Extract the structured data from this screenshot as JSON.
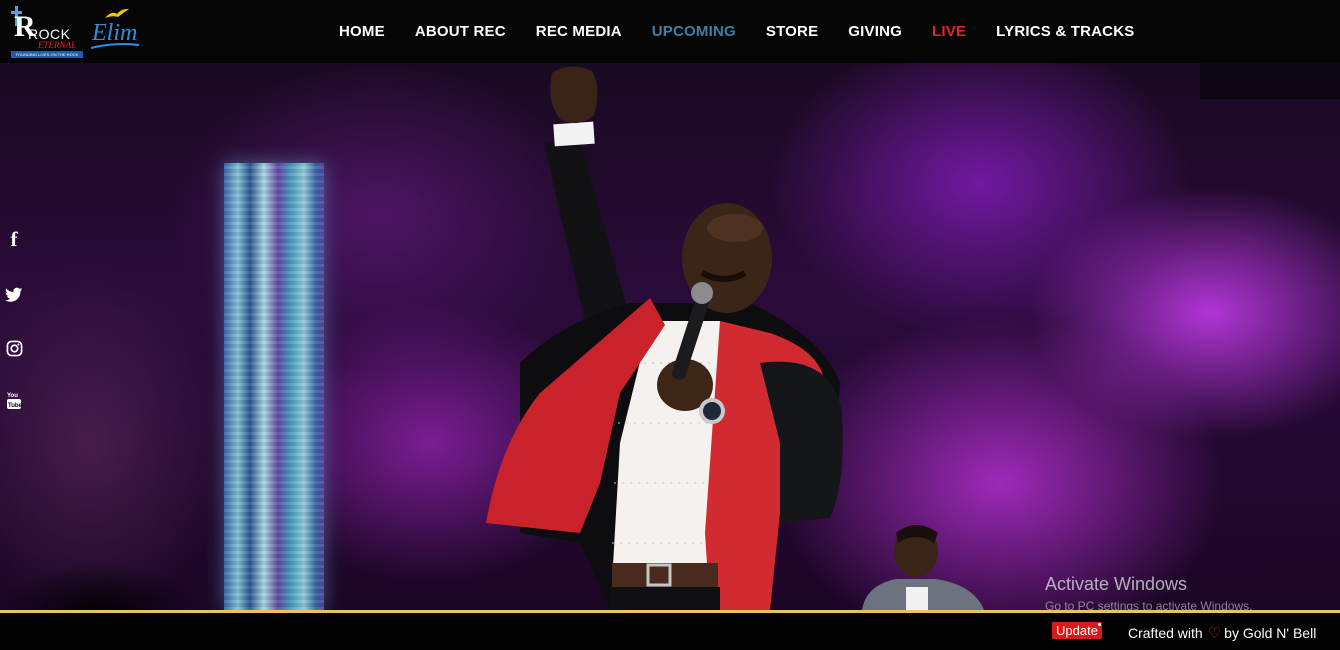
{
  "brand": {
    "rock_logo_text": "ROCK",
    "rock_logo_sub": "ETERNAL",
    "rock_logo_tagline": "FOUNDING LIVES ON THE ROCK",
    "elim_logo_text": "Elim"
  },
  "nav": {
    "items": [
      {
        "label": "HOME",
        "icon": "none"
      },
      {
        "label": "ABOUT REC",
        "icon": "none"
      },
      {
        "label": "REC MEDIA",
        "icon": "none"
      },
      {
        "label": "UPCOMING",
        "icon": "none"
      },
      {
        "label": "STORE",
        "icon": "none"
      },
      {
        "label": "GIVING",
        "icon": "none"
      },
      {
        "label": "LIVE",
        "icon": "none"
      },
      {
        "label": "LYRICS & TRACKS",
        "icon": "none"
      }
    ],
    "colors": {
      "default": "#ffffff",
      "upcoming": "#3f7fa6",
      "live": "#e3232b"
    }
  },
  "social": {
    "icons": [
      "facebook-icon",
      "twitter-icon",
      "instagram-icon",
      "youtube-icon"
    ],
    "facebook_glyph": "f"
  },
  "hero": {
    "image_subject": "worship leader singing into microphone on purple-lit stage"
  },
  "watermark": {
    "line1": "Activate Windows",
    "line2": "Go to PC settings to activate Windows."
  },
  "footer": {
    "update_label": "Update",
    "credit_prefix": "Crafted with",
    "credit_suffix": "by Gold N' Bell",
    "heart_glyph": "♡",
    "accent_color": "#e9c45a"
  }
}
